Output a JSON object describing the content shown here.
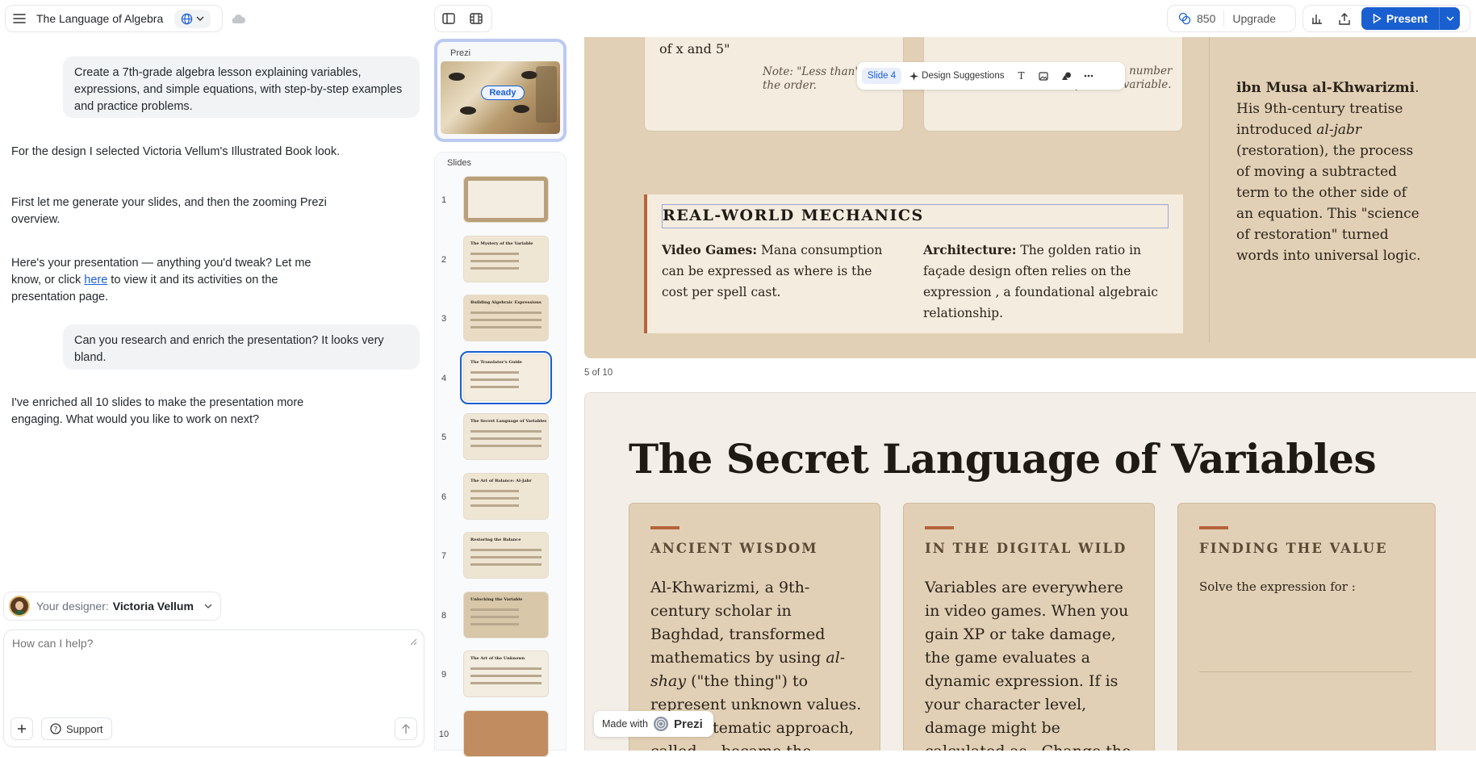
{
  "app": {
    "title": "The Language of Algebra",
    "credits": "850",
    "upgrade_label": "Upgrade",
    "present_label": "Present"
  },
  "chat": {
    "messages": [
      {
        "role": "user",
        "text": "Create a 7th-grade algebra lesson explaining variables, expressions, and simple equations, with step-by-step examples and practice problems."
      },
      {
        "role": "assistant",
        "text": "For the design I selected Victoria Vellum's Illustrated Book look."
      },
      {
        "role": "assistant",
        "text": "First let me generate your slides, and then the zooming Prezi overview."
      },
      {
        "role": "assistant",
        "text_before": "Here's your presentation — anything you'd tweak? Let me know, or click ",
        "link": "here",
        "text_after": " to view it and its activities on the presentation page."
      },
      {
        "role": "user",
        "text": "Can you research and enrich the presentation? It looks very bland."
      },
      {
        "role": "assistant",
        "text": "I've enriched all 10 slides to make the presentation more engaging. What would you like to work on next?"
      }
    ],
    "designer_label": "Your designer:",
    "designer_name": "Victoria Vellum",
    "input_placeholder": "How can I help?",
    "support_label": "Support"
  },
  "rail": {
    "prezi_label": "Prezi",
    "ready_label": "Ready",
    "slides_label": "Slides",
    "slides": [
      {
        "num": "1",
        "title": ""
      },
      {
        "num": "2",
        "title": "The Mystery of the Variable"
      },
      {
        "num": "3",
        "title": "Building Algebraic Expressions"
      },
      {
        "num": "4",
        "title": "The Translator's Guide"
      },
      {
        "num": "5",
        "title": "The Secret Language of Variables"
      },
      {
        "num": "6",
        "title": "The Art of Balance: Al-Jabr"
      },
      {
        "num": "7",
        "title": "Restoring the Balance"
      },
      {
        "num": "8",
        "title": "Unlocking the Variable"
      },
      {
        "num": "9",
        "title": "The Art of the Unknown"
      },
      {
        "num": "10",
        "title": ""
      }
    ],
    "selected_index": 4
  },
  "toolbar": {
    "slide_chip": "Slide 4",
    "design_suggestions": "Design Suggestions"
  },
  "slide4": {
    "card_left_text": "of x and 5\"",
    "note_left": "Note: \"Less than\" flips the order.",
    "card_right_top": "coefficient. The number sits before the variable.",
    "rw_heading": "REAL-WORLD MECHANICS",
    "video_label": "Video Games:",
    "video_text": " Mana consumption can be expressed as where is the cost per spell cast.",
    "arch_label": "Architecture:",
    "arch_text": " The golden ratio in façade design often relies on the expression , a foundational algebraic relationship.",
    "side_name": "ibn Musa al-Khwarizmi",
    "side_text_1": ". His 9th-century treatise introduced ",
    "side_italic": "al-jabr",
    "side_text_2": " (restoration), the process of moving a subtracted term to the other side of an equation. This \"science of restoration\" turned words into universal logic."
  },
  "slide5": {
    "counter": "5 of 10",
    "title": "The Secret Language of Variables",
    "cards": [
      {
        "heading": "ANCIENT WISDOM",
        "text_1": "Al-Khwarizmi, a 9th-century scholar in Baghdad, transformed mathematics by using ",
        "italic": "al-shay",
        "text_2": " (\"the thing\") to represent unknown values. This systematic approach, called ... became the founda-"
      },
      {
        "heading": "IN THE DIGITAL WILD",
        "text_1": "Variables are everywhere in video games. When you gain XP or take damage, the game evaluates a dynamic expression. If is your character level, damage might be calculated as . Change the level,",
        "italic": "",
        "text_2": ""
      },
      {
        "heading": "FINDING THE VALUE",
        "text_1": "Solve the expression for :",
        "italic": "",
        "text_2": ""
      }
    ]
  },
  "badge": {
    "made_with": "Made with",
    "brand": "Prezi"
  },
  "colors": {
    "accent": "#1a5fd0",
    "slide_bg": "#e2d0b6",
    "card_bg": "#f4ecdf",
    "rust": "#b5643c",
    "ink": "#1e1a14"
  }
}
